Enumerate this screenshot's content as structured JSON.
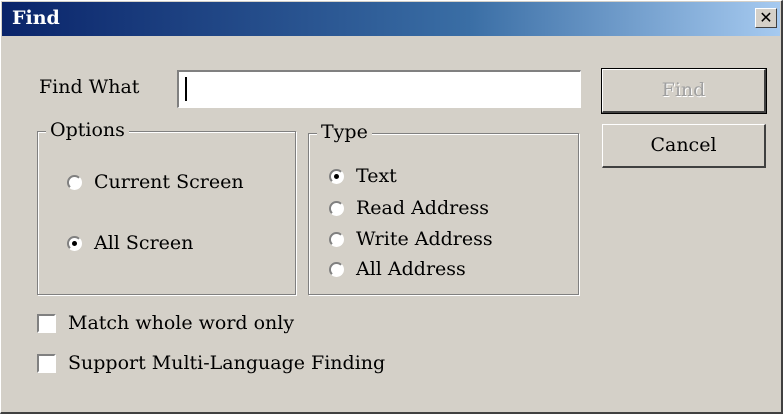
{
  "window": {
    "title": "Find",
    "close_glyph": "✕"
  },
  "find_what": {
    "label": "Find What",
    "value": "",
    "placeholder": ""
  },
  "buttons": {
    "find_label": "Find",
    "cancel_label": "Cancel"
  },
  "options": {
    "legend": "Options",
    "items": [
      {
        "label": "Current Screen",
        "selected": false
      },
      {
        "label": "All Screen",
        "selected": true
      }
    ]
  },
  "type": {
    "legend": "Type",
    "items": [
      {
        "label": "Text",
        "selected": true
      },
      {
        "label": "Read Address",
        "selected": false
      },
      {
        "label": "Write Address",
        "selected": false
      },
      {
        "label": "All Address",
        "selected": false
      }
    ]
  },
  "checkboxes": [
    {
      "label": "Match whole word only",
      "checked": false
    },
    {
      "label": "Support Multi-Language Finding",
      "checked": false
    }
  ]
}
